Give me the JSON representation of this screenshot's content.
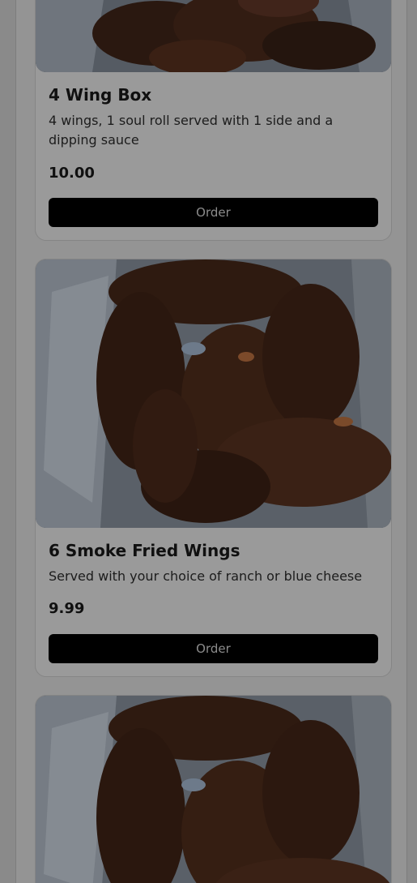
{
  "menu_items": [
    {
      "name": "4 Wing Box",
      "description": "4 wings, 1 soul roll served with 1 side and a dipping sauce",
      "price": "10.00",
      "button_label": "Order"
    },
    {
      "name": "6 Smoke Fried Wings",
      "description": "Served with your choice of ranch or blue cheese",
      "price": "9.99",
      "button_label": "Order"
    }
  ],
  "colors": {
    "overlay": "#8a8a8a",
    "button_bg": "#000000",
    "button_text": "#8c8c8c",
    "title_text": "#101010"
  }
}
